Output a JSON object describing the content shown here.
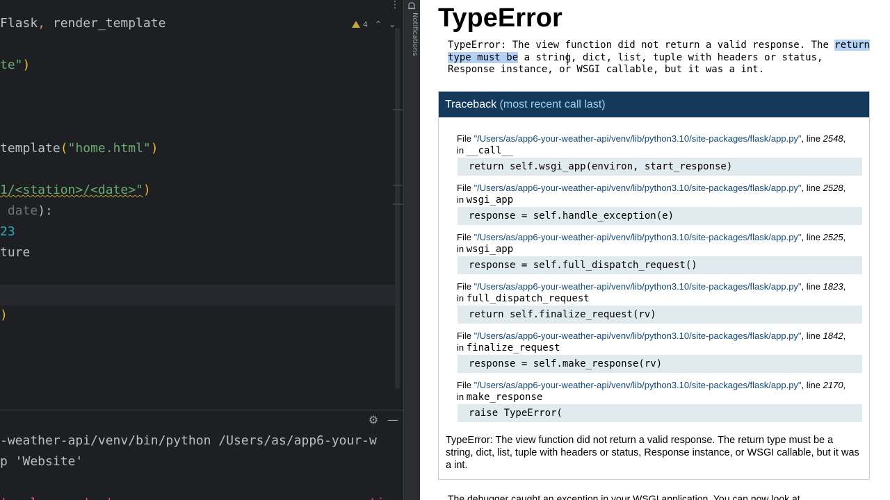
{
  "ide": {
    "editor": {
      "line_import": {
        "lib": "Flask",
        "comma": ",",
        "rest": " render_template"
      },
      "line_website": {
        "text": "te\"",
        "paren": ")"
      },
      "line_render": {
        "name": "template",
        "paren_open": "(",
        "str": "\"home.html\"",
        "paren_close": ")"
      },
      "line_route": {
        "str": "1/<station>/<date>\"",
        "paren": ")"
      },
      "line_def": {
        "param": " date",
        "rest": "):"
      },
      "line_num": {
        "value": "23"
      },
      "line_temp": {
        "text": "ture"
      },
      "line_close": {
        "text": ")"
      }
    },
    "inspection": {
      "count": "4"
    },
    "notifications_label": "Notifications",
    "console": {
      "line1": "-weather-api/venv/bin/python /Users/as/app6-your-w",
      "line2": "p 'Website'",
      "line3": "'   l      '  '                                  ti"
    },
    "colors": {
      "background": "#1e1f22",
      "keyword": "#cf8e6d",
      "string": "#6aab73",
      "number": "#2aacb8",
      "bracket": "#e8ba36"
    }
  },
  "browser": {
    "title": "TypeError",
    "message": {
      "part1": "TypeError: The view function did not return a valid response. The ",
      "selected": "return type must be",
      "part2": " a string, dict, list, tuple with headers or status, Response instance, or WSGI callable, but it was a int."
    },
    "traceback": {
      "header": "Traceback",
      "header_sub": " (most recent call last)",
      "file_word": "File ",
      "line_word": ", line ",
      "in_word": "in ",
      "frames": [
        {
          "path": "\"/Users/as/app6-your-weather-api/venv/lib/python3.10/site-packages/flask/app.py\"",
          "line": "2548",
          "func": "__call__",
          "code": "return self.wsgi_app(environ, start_response)"
        },
        {
          "path": "\"/Users/as/app6-your-weather-api/venv/lib/python3.10/site-packages/flask/app.py\"",
          "line": "2528",
          "func": "wsgi_app",
          "code": "response = self.handle_exception(e)"
        },
        {
          "path": "\"/Users/as/app6-your-weather-api/venv/lib/python3.10/site-packages/flask/app.py\"",
          "line": "2525",
          "func": "wsgi_app",
          "code": "response = self.full_dispatch_request()"
        },
        {
          "path": "\"/Users/as/app6-your-weather-api/venv/lib/python3.10/site-packages/flask/app.py\"",
          "line": "1823",
          "func": "full_dispatch_request",
          "code": "return self.finalize_request(rv)"
        },
        {
          "path": "\"/Users/as/app6-your-weather-api/venv/lib/python3.10/site-packages/flask/app.py\"",
          "line": "1842",
          "func": "finalize_request",
          "code": "response = self.make_response(rv)"
        },
        {
          "path": "\"/Users/as/app6-your-weather-api/venv/lib/python3.10/site-packages/flask/app.py\"",
          "line": "2170",
          "func": "make_response",
          "code": "raise TypeError("
        }
      ],
      "footer": "TypeError: The view function did not return a valid response. The return type must be a string, dict, list, tuple with headers or status, Response instance, or WSGI callable, but it was a int."
    },
    "debugger_note": "The debugger caught an exception in your WSGI application. You can now look at",
    "colors": {
      "header_bg": "#15395b",
      "path": "#13497b",
      "code_bg": "#e1ebef",
      "selection": "#b3d2f5"
    }
  }
}
